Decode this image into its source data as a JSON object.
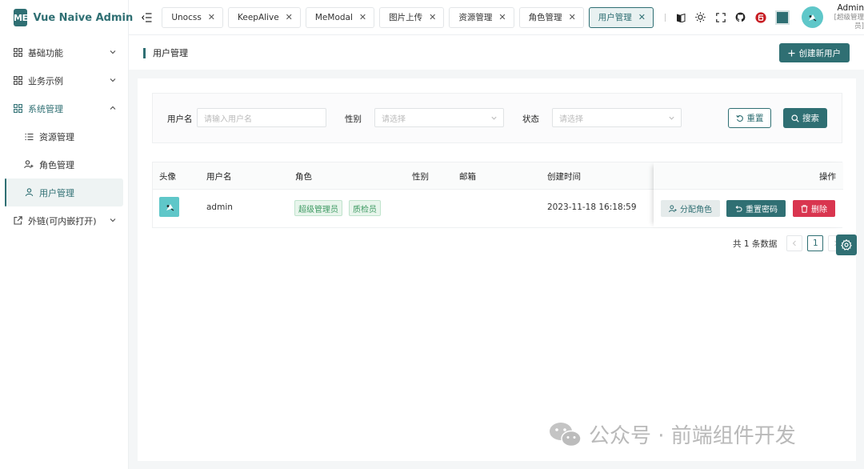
{
  "brand": {
    "logo": "ME",
    "title": "Vue Naive Admin"
  },
  "sidebar": {
    "items": [
      {
        "label": "基础功能",
        "icon": "grid-icon",
        "expanded": false
      },
      {
        "label": "业务示例",
        "icon": "grid-icon",
        "expanded": false
      },
      {
        "label": "系统管理",
        "icon": "grid-icon",
        "expanded": true
      },
      {
        "label": "资源管理",
        "icon": "list-icon"
      },
      {
        "label": "角色管理",
        "icon": "user-group-icon"
      },
      {
        "label": "用户管理",
        "icon": "user-icon",
        "active": true
      },
      {
        "label": "外链(可内嵌打开)",
        "icon": "external-link-icon",
        "expanded": false
      }
    ]
  },
  "header": {
    "tabs": [
      {
        "label": "Unocss"
      },
      {
        "label": "KeepAlive"
      },
      {
        "label": "MeModal"
      },
      {
        "label": "图片上传"
      },
      {
        "label": "资源管理"
      },
      {
        "label": "角色管理"
      },
      {
        "label": "用户管理",
        "active": true
      }
    ],
    "tools": [
      "book-icon",
      "sun-icon",
      "fullscreen-icon",
      "github-icon",
      "gitee-icon",
      "theme-color-swatch"
    ],
    "user": {
      "name": "Admin",
      "role": "[超级管理员]"
    }
  },
  "page": {
    "title": "用户管理",
    "create_button": "创建新用户"
  },
  "search": {
    "username_label": "用户名",
    "username_placeholder": "请输入用户名",
    "gender_label": "性别",
    "gender_placeholder": "请选择",
    "status_label": "状态",
    "status_placeholder": "请选择",
    "reset_button": "重置",
    "search_button": "搜索"
  },
  "table": {
    "columns": [
      "头像",
      "用户名",
      "角色",
      "性别",
      "邮箱",
      "创建时间",
      "操作"
    ],
    "rows": [
      {
        "username": "admin",
        "roles": [
          "超级管理员",
          "质检员"
        ],
        "gender": "",
        "email": "",
        "created_at": "2023-11-18 16:18:59",
        "actions": {
          "assign_role": "分配角色",
          "reset_password": "重置密码",
          "delete": "删除"
        }
      }
    ]
  },
  "pagination": {
    "total_text": "共 1 条数据",
    "current_page": "1"
  },
  "watermark": {
    "text": "公众号 · 前端组件开发"
  },
  "colors": {
    "primary": "#2f6f73",
    "danger": "#d9354f",
    "tag_green": "#3f9a63",
    "avatar_bg": "#5fc7c9"
  }
}
